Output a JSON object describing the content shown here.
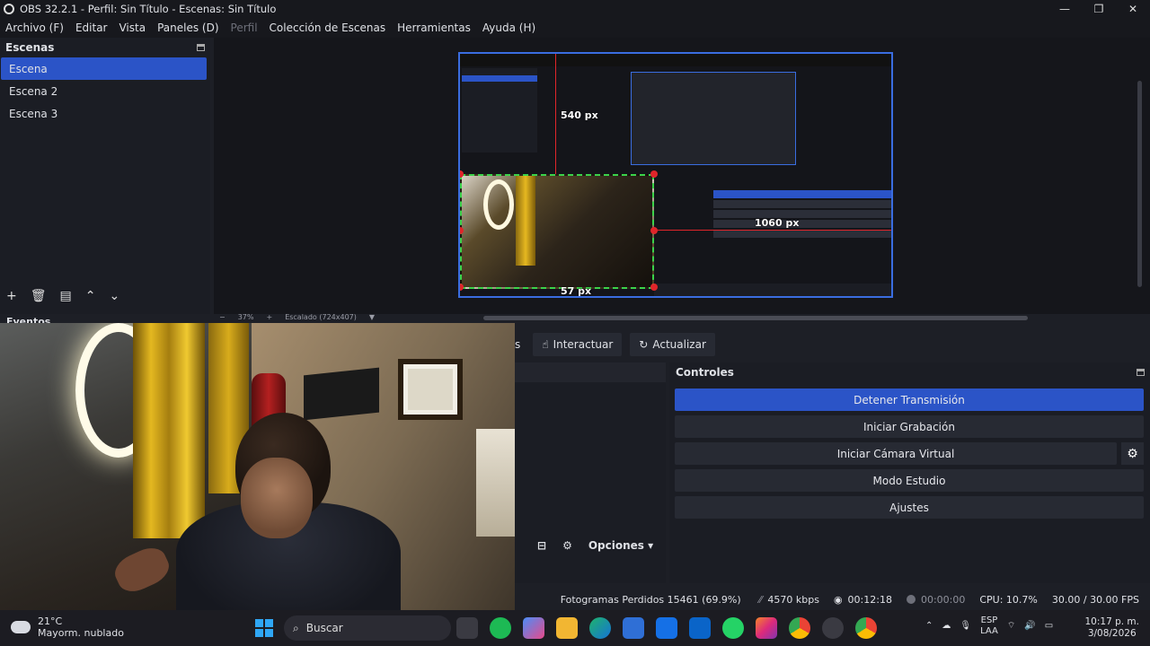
{
  "window": {
    "title": "OBS 32.2.1 - Perfil: Sin Título - Escenas: Sin Título",
    "controls": [
      "—",
      "❐",
      "✕"
    ]
  },
  "menu": [
    {
      "label": "Archivo (F)",
      "enabled": true
    },
    {
      "label": "Editar",
      "enabled": true
    },
    {
      "label": "Vista",
      "enabled": true
    },
    {
      "label": "Paneles (D)",
      "enabled": true
    },
    {
      "label": "Perfil",
      "enabled": false
    },
    {
      "label": "Colección de Escenas",
      "enabled": true
    },
    {
      "label": "Herramientas",
      "enabled": true
    },
    {
      "label": "Ayuda (H)",
      "enabled": true
    }
  ],
  "scenes": {
    "title": "Escenas",
    "items": [
      "Escena",
      "Escena 2",
      "Escena 3"
    ],
    "selected_index": 0,
    "tools": [
      "add-icon",
      "trash-icon",
      "filter-icon",
      "up-icon",
      "down-icon"
    ]
  },
  "preview": {
    "measure_top": "540 px",
    "measure_right": "1060 px",
    "measure_bottom": "57 px",
    "zoom_label": "37%",
    "scale_label": "Escalado (724x407)"
  },
  "events": {
    "title": "Eventos"
  },
  "toolbar": {
    "cut_label": "s",
    "interact_label": "Interactuar",
    "refresh_label": "Actualizar"
  },
  "mixer": {
    "options_label": "Opciones"
  },
  "controls": {
    "title": "Controles",
    "stop_stream": "Detener Transmisión",
    "start_recording": "Iniciar Grabación",
    "virtual_cam": "Iniciar Cámara Virtual",
    "studio_mode": "Modo Estudio",
    "settings": "Ajustes",
    "accent": "#2b54c7"
  },
  "status": {
    "dropped": "Fotogramas Perdidos 15461 (69.9%)",
    "bitrate": "4570 kbps",
    "stream_time": "00:12:18",
    "rec_time": "00:00:00",
    "cpu": "CPU: 10.7%",
    "fps": "30.00 / 30.00 FPS"
  },
  "taskbar": {
    "temp": "21°C",
    "weather": "Mayorm. nublado",
    "search": "Buscar",
    "lang1": "ESP",
    "lang2": "LAA",
    "time": "10:17 p. m.",
    "date": "3/08/2026"
  }
}
